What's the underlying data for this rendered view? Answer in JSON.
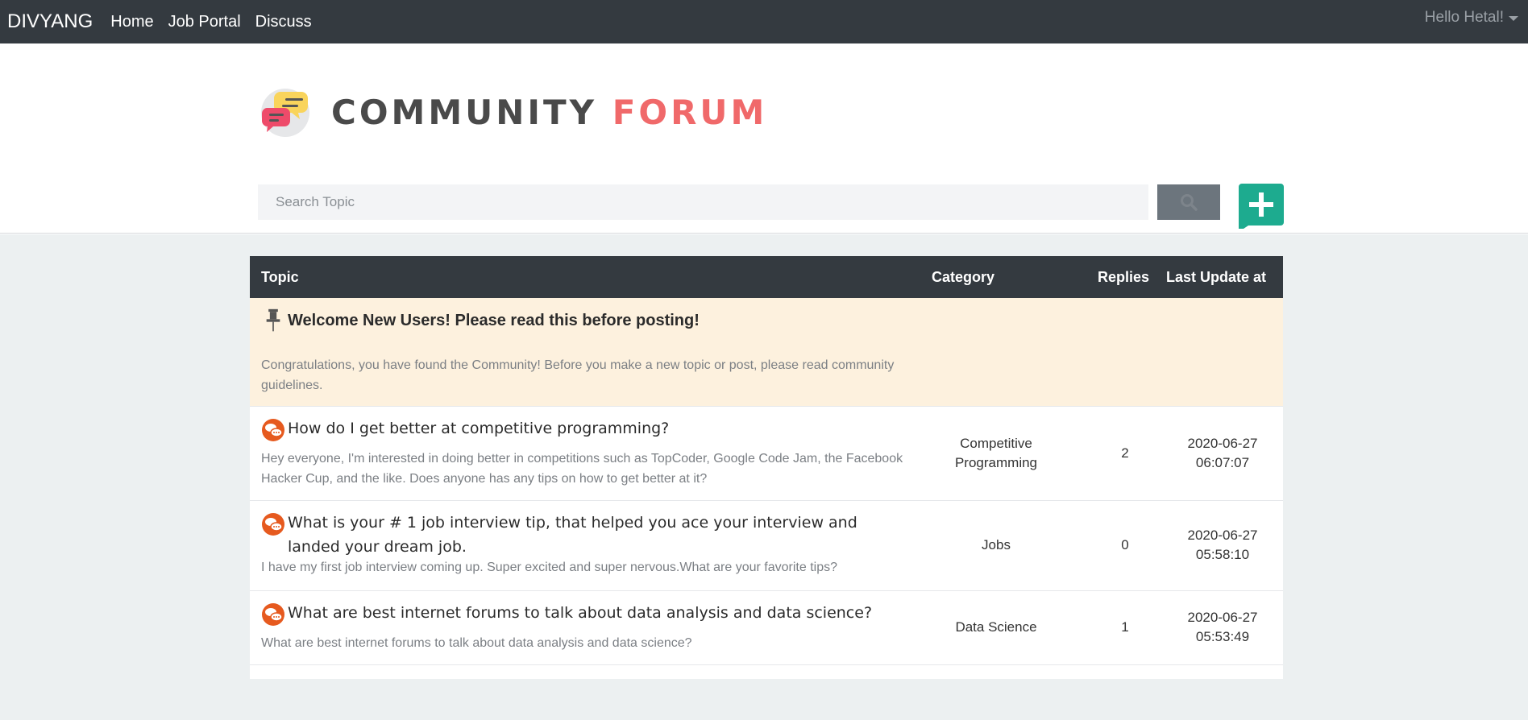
{
  "navbar": {
    "brand": "DIVYANG",
    "links": [
      "Home",
      "Job Portal",
      "Discuss"
    ],
    "user_greeting": "Hello Hetal!"
  },
  "header": {
    "title_part1": "COMMUNITY",
    "title_part2": "FORUM",
    "logo_icon": "chat-bubbles-icon"
  },
  "search": {
    "placeholder": "Search Topic",
    "value": "",
    "button_icon": "search-icon",
    "add_icon": "plus-icon"
  },
  "colors": {
    "navbar": "#343a40",
    "title_accent": "#f0696a",
    "add_button": "#1dab8f",
    "pinned_row": "#fdf1de",
    "topic_icon": "#e65a1f"
  },
  "table": {
    "headers": {
      "topic": "Topic",
      "category": "Category",
      "replies": "Replies",
      "last_update": "Last Update at"
    },
    "pinned": {
      "title": "Welcome New Users! Please read this before posting!",
      "description_line1": "Congratulations, you have found the Community! Before you make a new topic or post, please read community",
      "description_line2": "guidelines.",
      "icon": "pushpin-icon"
    },
    "rows": [
      {
        "title": "How do I get better at competitive programming?",
        "description_line1": "Hey everyone, I'm interested in doing better in competitions such as TopCoder, Google Code Jam, the Facebook",
        "description_line2": "Hacker Cup, and the like. Does anyone has any tips on how to get better at it?",
        "category_line1": "Competitive",
        "category_line2": "Programming",
        "replies": "2",
        "date": "2020-06-27",
        "time": "06:07:07"
      },
      {
        "title_line1": "What is your # 1 job interview tip, that helped you ace your interview and",
        "title_line2": "landed your dream job.",
        "description_line1": "I have my first job interview coming up. Super excited and super nervous.What are your favorite tips?",
        "category_line1": "Jobs",
        "replies": "0",
        "date": "2020-06-27",
        "time": "05:58:10"
      },
      {
        "title": "What are best internet forums to talk about data analysis and data science?",
        "description_line1": "What are best internet forums to talk about data analysis and data science?",
        "category_line1": "Data Science",
        "replies": "1",
        "date": "2020-06-27",
        "time": "05:53:49"
      }
    ]
  }
}
